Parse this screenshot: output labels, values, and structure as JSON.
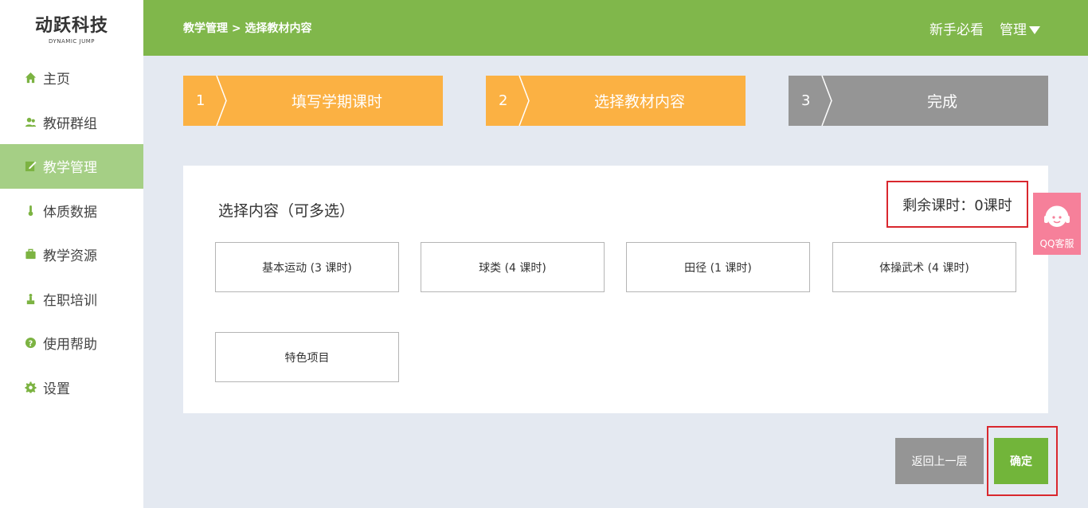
{
  "logo": {
    "main": "动跃科技",
    "sub": "DYNAMIC JUMP"
  },
  "sidebar": {
    "items": [
      {
        "label": "主页",
        "icon": "home-icon"
      },
      {
        "label": "教研群组",
        "icon": "users-icon"
      },
      {
        "label": "教学管理",
        "icon": "edit-icon",
        "active": true
      },
      {
        "label": "体质数据",
        "icon": "thermometer-icon"
      },
      {
        "label": "教学资源",
        "icon": "briefcase-icon"
      },
      {
        "label": "在职培训",
        "icon": "trophy-icon"
      },
      {
        "label": "使用帮助",
        "icon": "help-icon"
      },
      {
        "label": "设置",
        "icon": "gear-icon"
      }
    ]
  },
  "header": {
    "breadcrumb": "教学管理 > 选择教材内容",
    "guide_link": "新手必看",
    "manage_menu": "管理"
  },
  "steps": [
    {
      "num": "1",
      "label": "填写学期课时",
      "status": "done"
    },
    {
      "num": "2",
      "label": "选择教材内容",
      "status": "current"
    },
    {
      "num": "3",
      "label": "完成",
      "status": "pending"
    }
  ],
  "panel": {
    "title": "选择内容（可多选）",
    "remaining": "剩余课时：0课时",
    "options": [
      "基本运动 (3 课时)",
      "球类 (4 课时)",
      "田径 (1 课时)",
      "体操武术 (4 课时)",
      "特色项目"
    ]
  },
  "buttons": {
    "back": "返回上一层",
    "confirm": "确定"
  },
  "qq": {
    "label": "QQ客服"
  },
  "colors": {
    "header_green": "#80b74b",
    "sidebar_active": "#a5cf85",
    "step_active": "#fbb143",
    "step_pending": "#959595",
    "highlight_red": "#d9272e",
    "confirm_green": "#72b53a",
    "qq_pink": "#f6809a"
  }
}
